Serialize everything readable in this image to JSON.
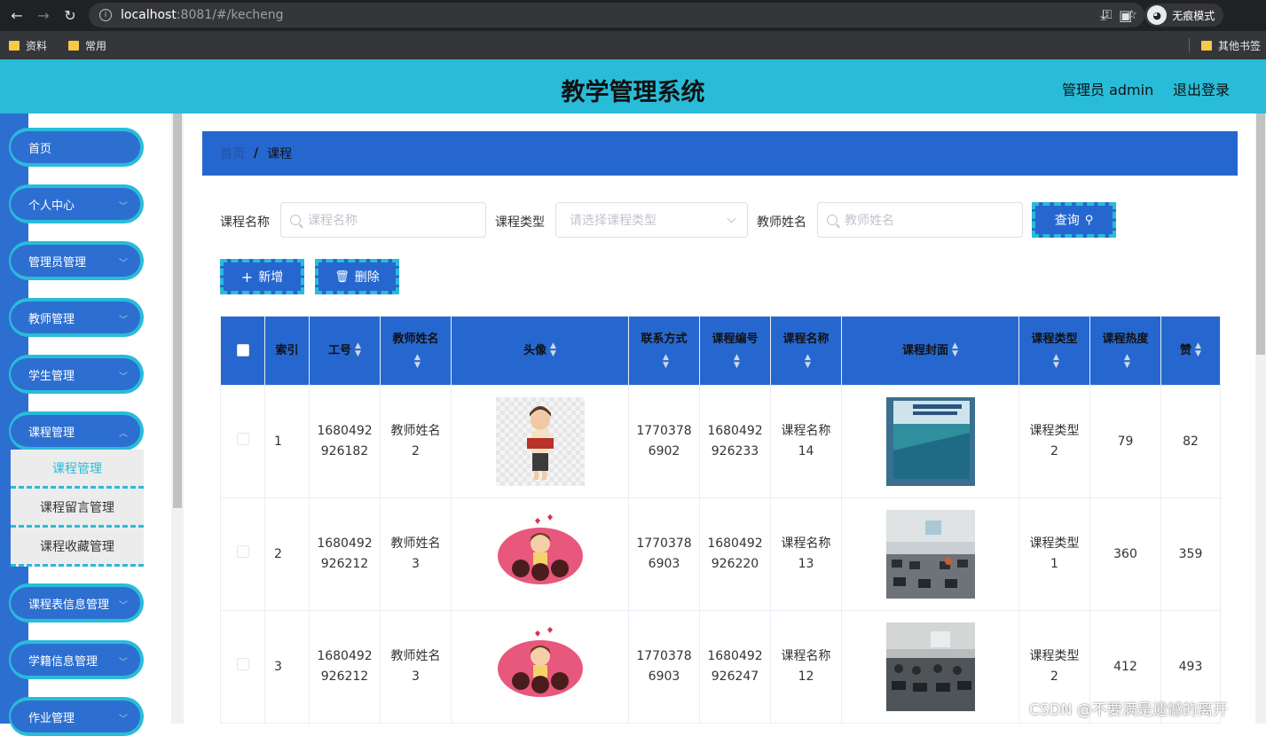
{
  "browser": {
    "url_host": "localhost",
    "url_path": ":8081/#/kecheng",
    "incognito_label": "无痕模式",
    "bookmarks": [
      "资料",
      "常用"
    ],
    "other_bookmarks": "其他书签"
  },
  "header": {
    "title": "教学管理系统",
    "user": "管理员 admin",
    "logout": "退出登录"
  },
  "sidebar": {
    "items": [
      {
        "label": "首页",
        "has_chevron": false
      },
      {
        "label": "个人中心",
        "has_chevron": true
      },
      {
        "label": "管理员管理",
        "has_chevron": true
      },
      {
        "label": "教师管理",
        "has_chevron": true
      },
      {
        "label": "学生管理",
        "has_chevron": true
      },
      {
        "label": "课程管理",
        "has_chevron": true
      }
    ],
    "submenu": [
      "课程管理",
      "课程留言管理",
      "课程收藏管理"
    ],
    "items_after": [
      {
        "label": "课程表信息管理"
      },
      {
        "label": "学籍信息管理"
      },
      {
        "label": "作业管理"
      }
    ]
  },
  "breadcrumb": {
    "home": "首页",
    "separator": "/",
    "current": "课程"
  },
  "filters": {
    "course_name_label": "课程名称",
    "course_name_placeholder": "课程名称",
    "course_type_label": "课程类型",
    "course_type_placeholder": "请选择课程类型",
    "teacher_name_label": "教师姓名",
    "teacher_name_placeholder": "教师姓名",
    "query_button": "查询"
  },
  "actions": {
    "add": "新增",
    "delete": "删除"
  },
  "table": {
    "headers": {
      "index": "索引",
      "job_no": "工号",
      "teacher_name": "教师姓名",
      "avatar": "头像",
      "contact": "联系方式",
      "course_no": "课程编号",
      "course_name": "课程名称",
      "cover": "课程封面",
      "course_type": "课程类型",
      "popularity": "课程热度",
      "likes": "赞"
    },
    "rows": [
      {
        "index": "1",
        "job_no_1": "1680492",
        "job_no_2": "926182",
        "teacher_1": "教师姓名",
        "teacher_2": "2",
        "contact_1": "1770378",
        "contact_2": "6902",
        "course_no_1": "1680492",
        "course_no_2": "926233",
        "course_name_1": "课程名称",
        "course_name_2": "14",
        "type_1": "课程类型",
        "type_2": "2",
        "popularity": "79",
        "likes": "82",
        "avatar_icon": "teacher-reading-avatar",
        "cover_icon": "book-cover"
      },
      {
        "index": "2",
        "job_no_1": "1680492",
        "job_no_2": "926212",
        "teacher_1": "教师姓名",
        "teacher_2": "3",
        "contact_1": "1770378",
        "contact_2": "6903",
        "course_no_1": "1680492",
        "course_no_2": "926220",
        "course_name_1": "课程名称",
        "course_name_2": "13",
        "type_1": "课程类型",
        "type_2": "1",
        "popularity": "360",
        "likes": "359",
        "avatar_icon": "teacher-with-students-avatar",
        "cover_icon": "computer-classroom-photo"
      },
      {
        "index": "3",
        "job_no_1": "1680492",
        "job_no_2": "926212",
        "teacher_1": "教师姓名",
        "teacher_2": "3",
        "contact_1": "1770378",
        "contact_2": "6903",
        "course_no_1": "1680492",
        "course_no_2": "926247",
        "course_name_1": "课程名称",
        "course_name_2": "12",
        "type_1": "课程类型",
        "type_2": "2",
        "popularity": "412",
        "likes": "493",
        "avatar_icon": "teacher-with-students-avatar",
        "cover_icon": "computer-classroom-photo"
      }
    ]
  },
  "watermark": "CSDN @不要满是遗憾的离开",
  "colors": {
    "header": "#29bcd9",
    "primary": "#2667cf",
    "sidebar": "#2d6fd1"
  }
}
